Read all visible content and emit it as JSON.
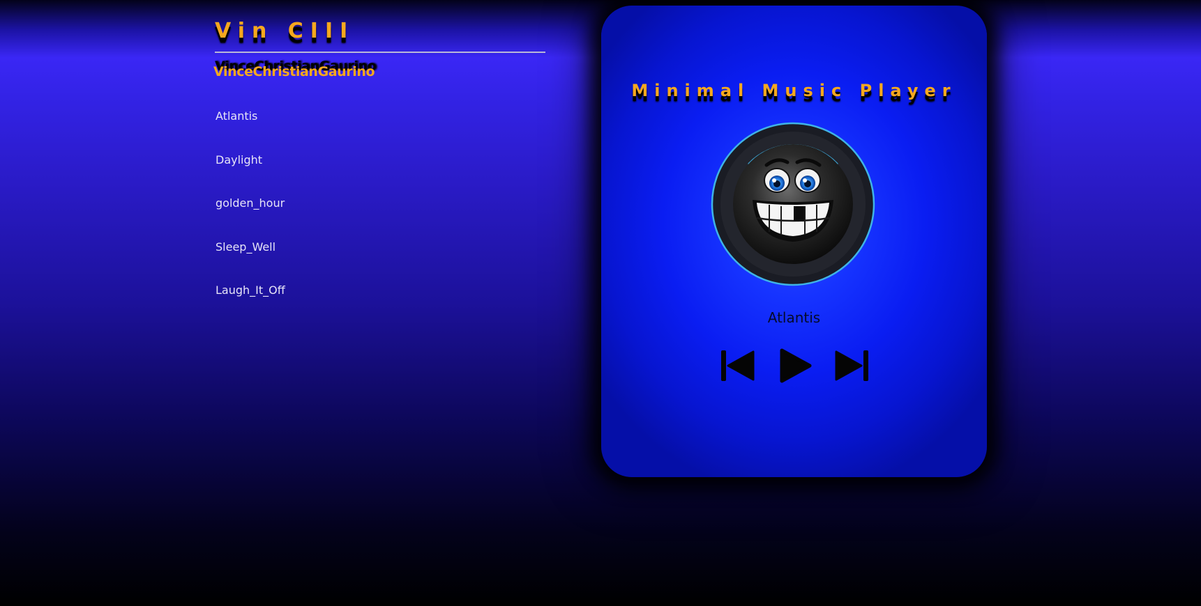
{
  "brand": {
    "title": "Vin CIII",
    "author": "VinceChristianGaurino"
  },
  "playlist": [
    {
      "label": "Atlantis"
    },
    {
      "label": "Daylight"
    },
    {
      "label": "golden_hour"
    },
    {
      "label": "Sleep_Well"
    },
    {
      "label": "Laugh_It_Off"
    }
  ],
  "player": {
    "title": "Minimal Music Player",
    "current_track": "Atlantis",
    "controls": {
      "previous_icon": "skip-previous-icon",
      "play_icon": "play-icon",
      "next_icon": "skip-next-icon"
    },
    "artwork_icon": "grinning-face-icon"
  },
  "colors": {
    "accent": "#f6a81e",
    "card": "#0a1df2",
    "progress_ring": "#3fb3e6"
  }
}
